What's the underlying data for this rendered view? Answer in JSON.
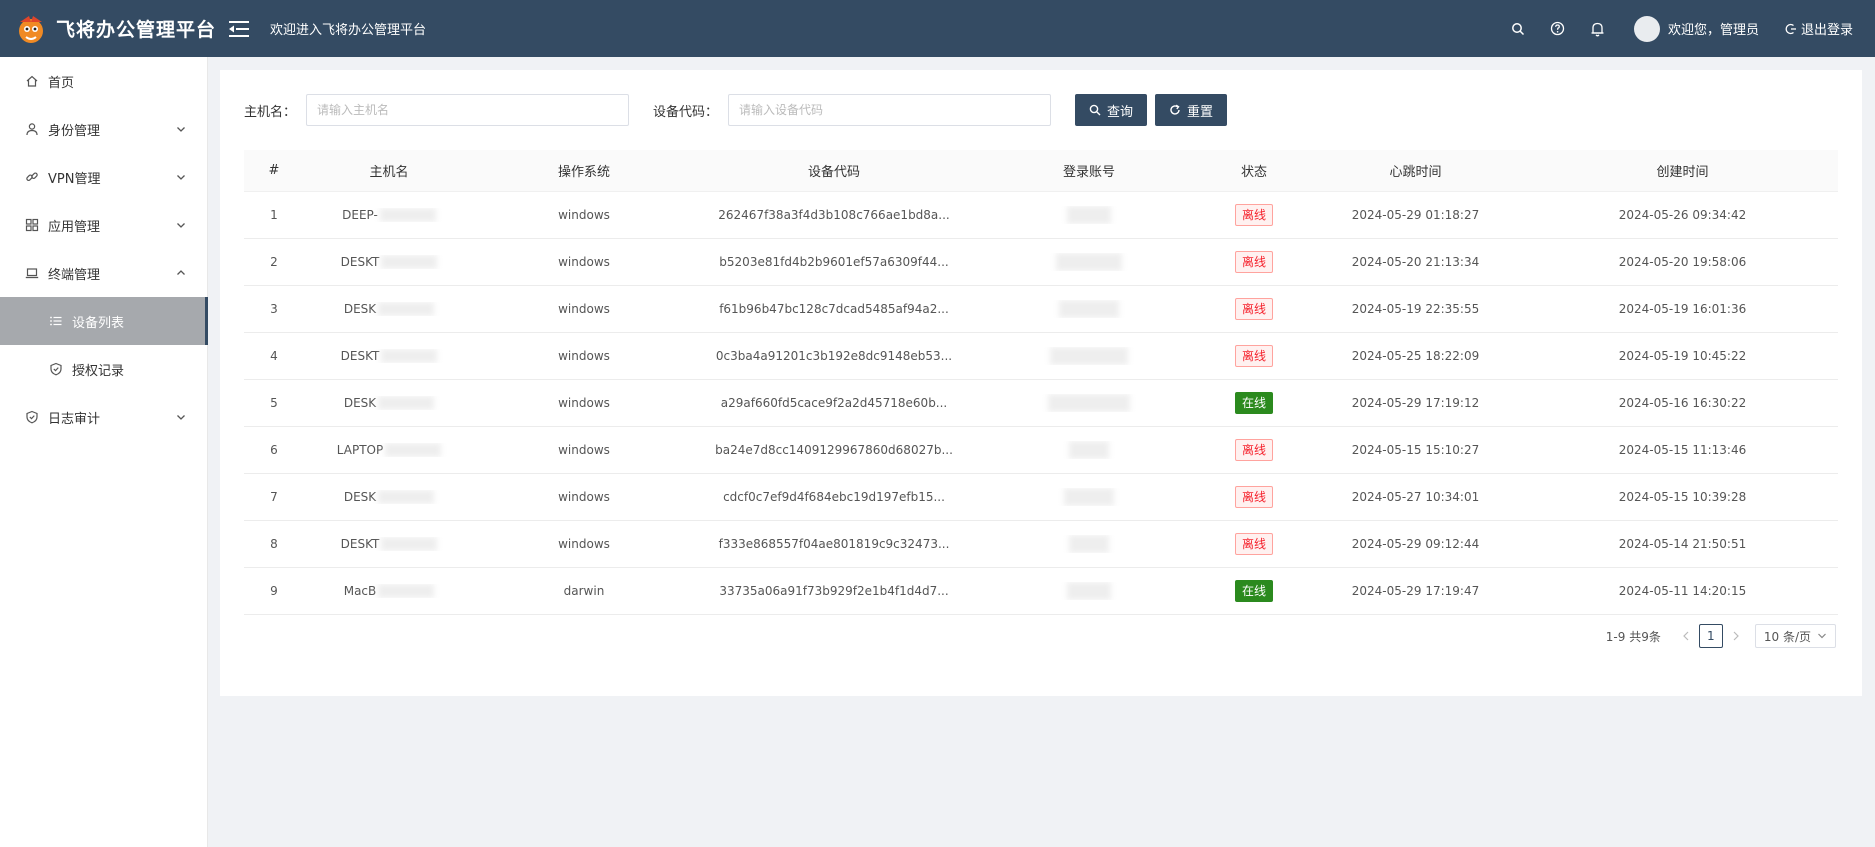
{
  "header": {
    "brand_title": "飞将办公管理平台",
    "welcome": "欢迎进入飞将办公管理平台",
    "greeting": "欢迎您，管理员",
    "logout": "退出登录"
  },
  "sidebar": {
    "items": [
      {
        "label": "首页",
        "icon": "home-icon"
      },
      {
        "label": "身份管理",
        "icon": "user-icon"
      },
      {
        "label": "VPN管理",
        "icon": "link-icon"
      },
      {
        "label": "应用管理",
        "icon": "grid-icon"
      },
      {
        "label": "终端管理",
        "icon": "laptop-icon"
      },
      {
        "label": "设备列表",
        "icon": "list-icon"
      },
      {
        "label": "授权记录",
        "icon": "shield-icon"
      },
      {
        "label": "日志审计",
        "icon": "shield-icon"
      }
    ]
  },
  "filter": {
    "hostname_label": "主机名：",
    "hostname_placeholder": "请输入主机名",
    "device_label": "设备代码：",
    "device_placeholder": "请输入设备代码",
    "query_label": "查询",
    "reset_label": "重置"
  },
  "table": {
    "headers": [
      "#",
      "主机名",
      "操作系统",
      "设备代码",
      "登录账号",
      "状态",
      "心跳时间",
      "创建时间"
    ],
    "rows": [
      {
        "idx": "1",
        "host": "DEEP-",
        "os": "windows",
        "code": "262467f38a3f4d3b108c766ae1bd8a...",
        "status": "离线",
        "online": false,
        "heartbeat": "2024-05-29 01:18:27",
        "created": "2024-05-26 09:34:42"
      },
      {
        "idx": "2",
        "host": "DESKT",
        "os": "windows",
        "code": "b5203e81fd4b2b9601ef57a6309f44...",
        "status": "离线",
        "online": false,
        "heartbeat": "2024-05-20 21:13:34",
        "created": "2024-05-20 19:58:06"
      },
      {
        "idx": "3",
        "host": "DESK",
        "os": "windows",
        "code": "f61b96b47bc128c7dcad5485af94a2...",
        "status": "离线",
        "online": false,
        "heartbeat": "2024-05-19 22:35:55",
        "created": "2024-05-19 16:01:36"
      },
      {
        "idx": "4",
        "host": "DESKT",
        "os": "windows",
        "code": "0c3ba4a91201c3b192e8dc9148eb53...",
        "status": "离线",
        "online": false,
        "heartbeat": "2024-05-25 18:22:09",
        "created": "2024-05-19 10:45:22"
      },
      {
        "idx": "5",
        "host": "DESK",
        "os": "windows",
        "code": "a29af660fd5cace9f2a2d45718e60b...",
        "status": "在线",
        "online": true,
        "heartbeat": "2024-05-29 17:19:12",
        "created": "2024-05-16 16:30:22"
      },
      {
        "idx": "6",
        "host": "LAPTOP",
        "os": "windows",
        "code": "ba24e7d8cc1409129967860d68027b...",
        "status": "离线",
        "online": false,
        "heartbeat": "2024-05-15 15:10:27",
        "created": "2024-05-15 11:13:46"
      },
      {
        "idx": "7",
        "host": "DESK",
        "os": "windows",
        "code": "cdcf0c7ef9d4f684ebc19d197efb15...",
        "status": "离线",
        "online": false,
        "heartbeat": "2024-05-27 10:34:01",
        "created": "2024-05-15 10:39:28"
      },
      {
        "idx": "8",
        "host": "DESKT",
        "os": "windows",
        "code": "f333e868557f04ae801819c9c32473...",
        "status": "离线",
        "online": false,
        "heartbeat": "2024-05-29 09:12:44",
        "created": "2024-05-14 21:50:51"
      },
      {
        "idx": "9",
        "host": "MacB",
        "os": "darwin",
        "code": "33735a06a91f73b929f2e1b4f1d4d7...",
        "status": "在线",
        "online": true,
        "heartbeat": "2024-05-29 17:19:47",
        "created": "2024-05-11 14:20:15"
      }
    ]
  },
  "pagination": {
    "total": "1-9 共9条",
    "current": "1",
    "page_size": "10 条/页"
  },
  "colors": {
    "header_bg": "#344b63",
    "online": "#2b8a1e",
    "offline": "#f5222d"
  }
}
